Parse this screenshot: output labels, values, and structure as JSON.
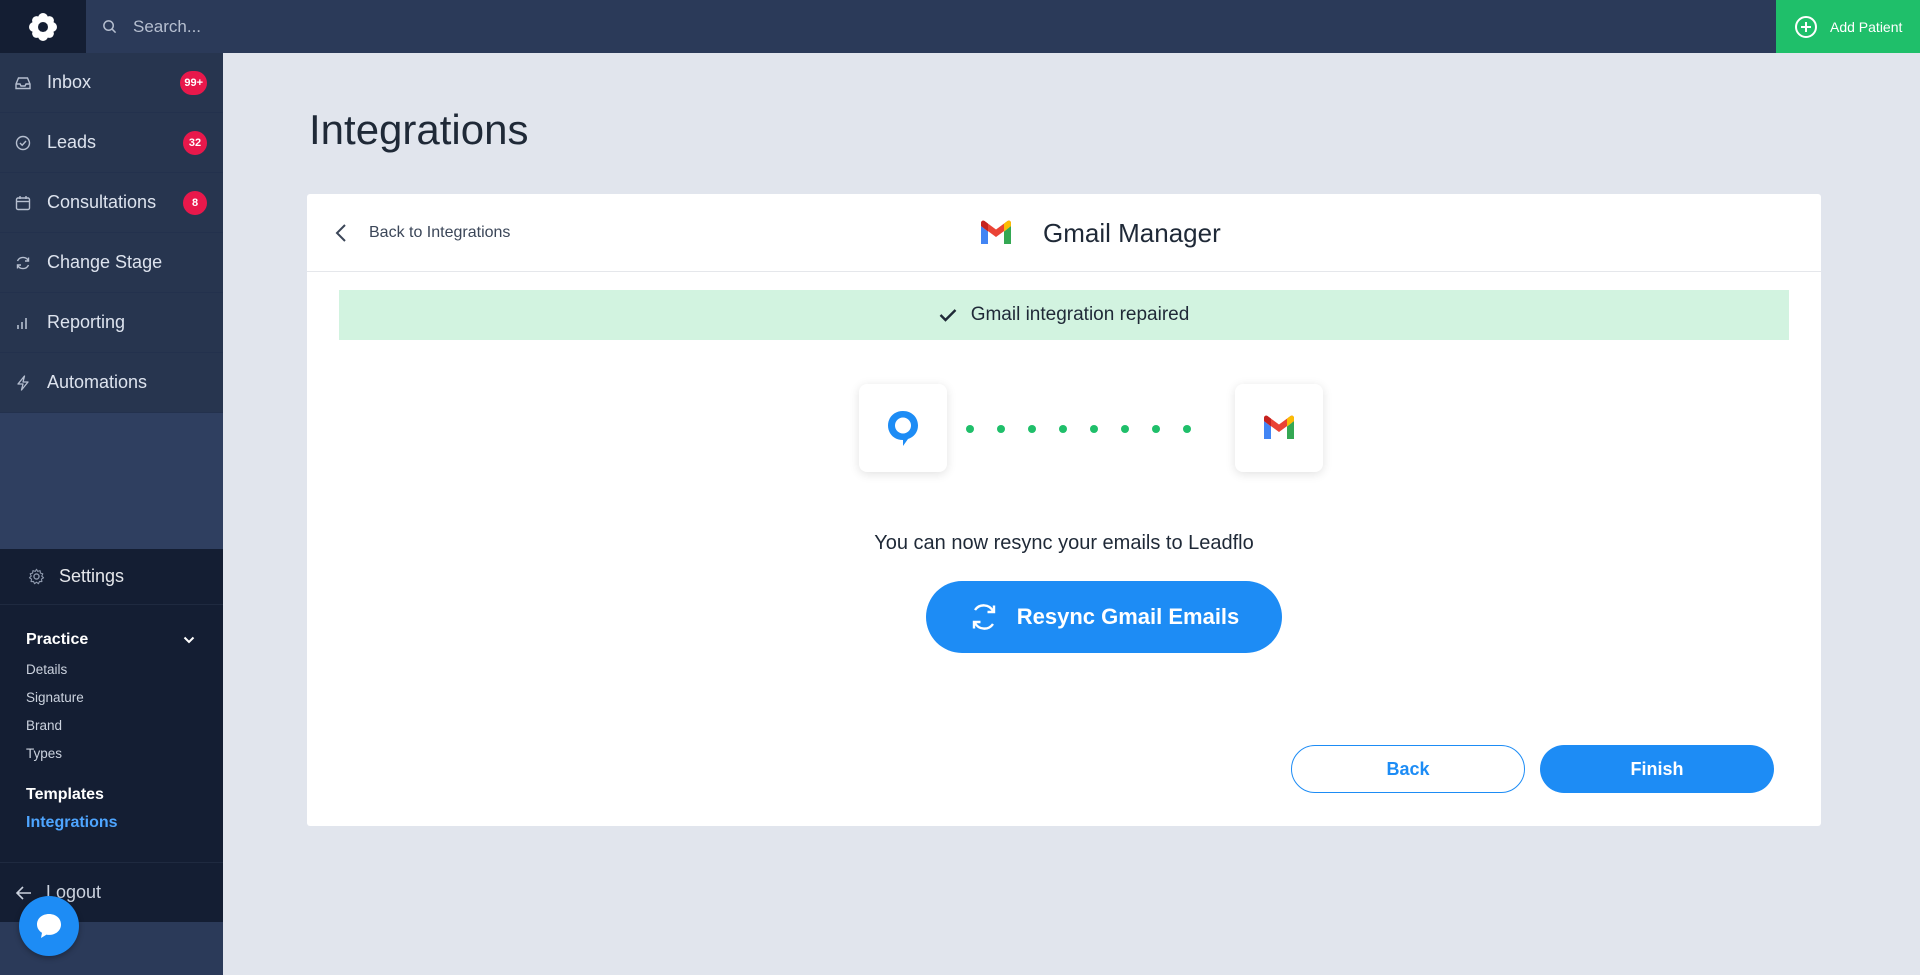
{
  "search": {
    "placeholder": "Search..."
  },
  "header": {
    "add_patient_label": "Add Patient"
  },
  "sidebar": {
    "items": [
      {
        "label": "Inbox",
        "badge": "99+",
        "icon": "inbox-icon"
      },
      {
        "label": "Leads",
        "badge": "32",
        "icon": "check-circle-icon"
      },
      {
        "label": "Consultations",
        "badge": "8",
        "icon": "calendar-icon"
      },
      {
        "label": "Change Stage",
        "badge": "",
        "icon": "refresh-icon"
      },
      {
        "label": "Reporting",
        "badge": "",
        "icon": "bar-chart-icon"
      },
      {
        "label": "Automations",
        "badge": "",
        "icon": "lightning-icon"
      }
    ],
    "settings_label": "Settings",
    "practice_label": "Practice",
    "practice_items": [
      "Details",
      "Signature",
      "Brand",
      "Types"
    ],
    "templates_label": "Templates",
    "integrations_label": "Integrations",
    "logout_label": "Logout"
  },
  "main": {
    "page_title": "Integrations",
    "back_link": "Back to Integrations",
    "card_title": "Gmail Manager",
    "success_message": "Gmail integration repaired",
    "resync_text": "You can now resync your emails to Leadflo",
    "resync_button": "Resync Gmail Emails",
    "back_button": "Back",
    "finish_button": "Finish"
  },
  "colors": {
    "accent": "#1d8cf5",
    "success": "#1fbf6a",
    "badge": "#e8184b",
    "sidebar": "#2b3a59"
  }
}
